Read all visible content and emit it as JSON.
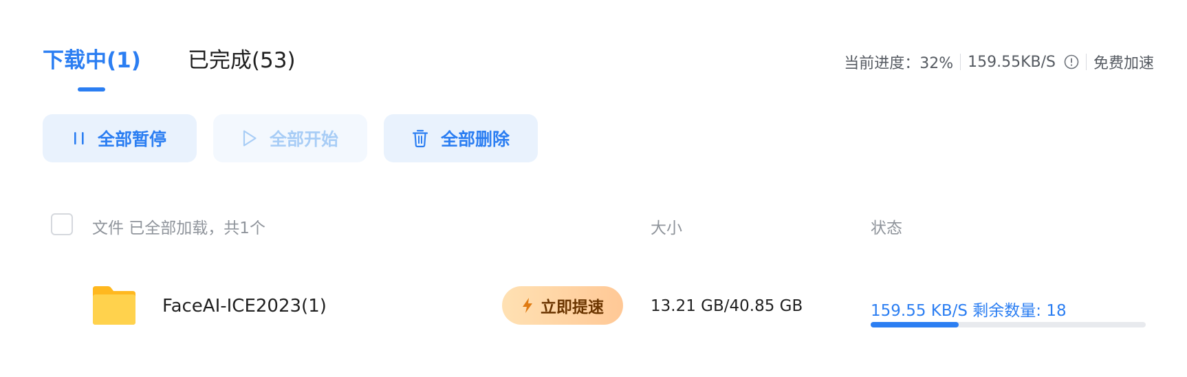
{
  "tabs": [
    {
      "label": "下载中(1)",
      "active": true
    },
    {
      "label": "已完成(53)",
      "active": false
    }
  ],
  "status_bar": {
    "progress_text": "当前进度：32%",
    "speed": "159.55KB/S",
    "info_icon": "info-circle-icon",
    "free_boost": "免费加速"
  },
  "actions": {
    "pause_all": "全部暂停",
    "start_all": "全部开始",
    "delete_all": "全部删除"
  },
  "list_header": {
    "file": "文件 已全部加载，共1个",
    "size": "大小",
    "status": "状态"
  },
  "files": [
    {
      "name": "FaceAI-ICE2023(1)",
      "icon": "folder-icon",
      "boost_label": "立即提速",
      "size": "13.21 GB/40.85 GB",
      "status": "159.55 KB/S 剩余数量: 18",
      "progress": 0.32
    }
  ],
  "colors": {
    "accent": "#2b7ef2",
    "boost_gradient_start": "#ffe1b3",
    "boost_gradient_end": "#ffc896",
    "folder": "#ffc93c"
  }
}
